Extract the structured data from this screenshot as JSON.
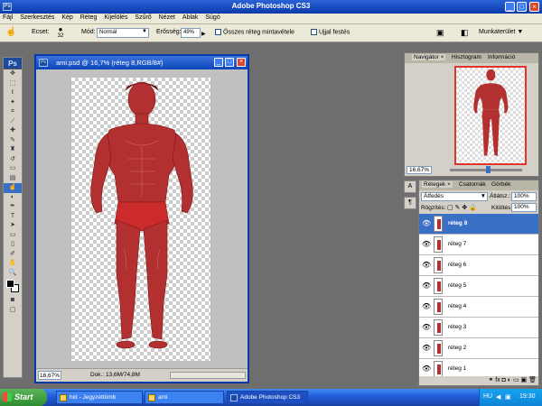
{
  "app": {
    "title": "Adobe Photoshop CS3"
  },
  "menu": [
    "Fájl",
    "Szerkesztés",
    "Kép",
    "Réteg",
    "Kijelölés",
    "Szűrő",
    "Nézet",
    "Ablak",
    "Súgó"
  ],
  "options": {
    "ecset_label": "Ecset:",
    "brush_size": "32",
    "mod_label": "Mód:",
    "mod_value": "Normál",
    "erosseg_label": "Erősség:",
    "erosseg_value": "49%",
    "all_layers_label": "Összes réteg mintavétele",
    "finger_paint_label": "Ujjal festés",
    "workspace_label": "Munkaterület ▼"
  },
  "document": {
    "title": "ami.psd @ 16,7% (réteg 8,RGB/8#)",
    "zoom": "16,67%",
    "dok": "Dok.: 13,6M/74,8M"
  },
  "navigator": {
    "tabs": [
      "Navigátor ×",
      "Hisztogram",
      "Információ"
    ],
    "zoom": "16,67%"
  },
  "layers": {
    "tabs": [
      "Rétegek ×",
      "Csatornák",
      "Görbék"
    ],
    "blend_mode": "Átfedés",
    "opacity_label": "Átlátsz.:",
    "opacity_value": "100%",
    "lock_label": "Rögzítés:",
    "fill_label": "Kitöltés:",
    "fill_value": "100%",
    "items": [
      {
        "name": "réteg 8"
      },
      {
        "name": "réteg 7"
      },
      {
        "name": "réteg 6"
      },
      {
        "name": "réteg 5"
      },
      {
        "name": "réteg 4"
      },
      {
        "name": "réteg 3"
      },
      {
        "name": "réteg 2"
      },
      {
        "name": "réteg 1"
      }
    ],
    "selected_index": 0
  },
  "taskbar": {
    "start": "Start",
    "tasks": [
      "hid - Jegyzettömb",
      "ami",
      "Adobe Photoshop CS3"
    ],
    "lang": "HU",
    "clock": "19:30"
  },
  "colors": {
    "accent": "#3a6fc6",
    "title_blue": "#0a3aa8",
    "figure_red": "#b33030"
  }
}
